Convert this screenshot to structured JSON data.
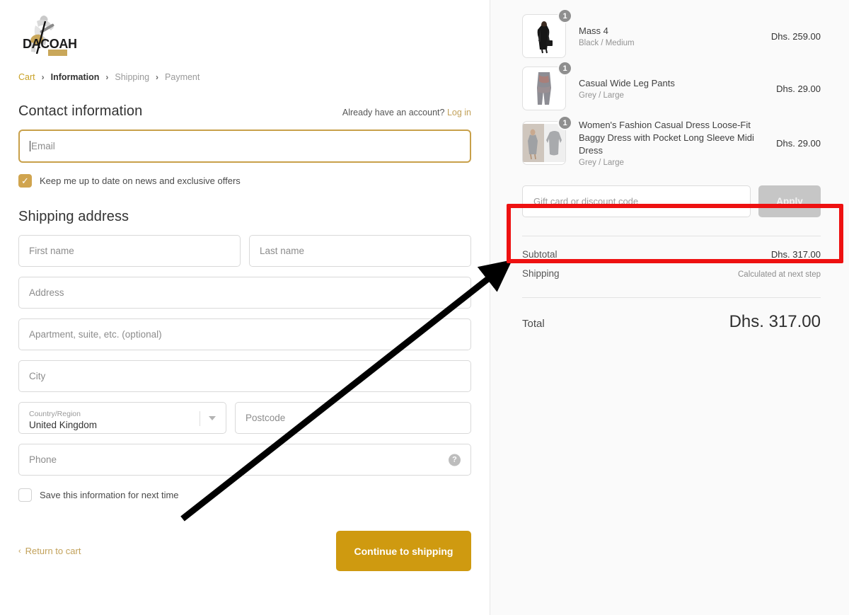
{
  "brand": {
    "name": "DACOAH",
    "logo_icon": "guitarist-logo",
    "accent": "#cf9a10",
    "link_gold": "#c2a15a"
  },
  "breadcrumb": [
    {
      "label": "Cart",
      "state": "link"
    },
    {
      "label": "Information",
      "state": "current"
    },
    {
      "label": "Shipping",
      "state": "muted"
    },
    {
      "label": "Payment",
      "state": "muted"
    }
  ],
  "breadcrumb_separator": "›",
  "contact": {
    "title": "Contact information",
    "account_prompt": "Already have an account?",
    "login_label": "Log in",
    "email_placeholder": "Email",
    "email_value": "",
    "newsletter_label": "Keep me up to date on news and exclusive offers",
    "newsletter_checked": true,
    "check_glyph": "✓"
  },
  "shipping": {
    "title": "Shipping address",
    "first_name_placeholder": "First name",
    "last_name_placeholder": "Last name",
    "address_placeholder": "Address",
    "apartment_placeholder": "Apartment, suite, etc. (optional)",
    "city_placeholder": "City",
    "country_label": "Country/Region",
    "country_value": "United Kingdom",
    "postcode_placeholder": "Postcode",
    "phone_placeholder": "Phone",
    "phone_help_glyph": "?",
    "save_info_label": "Save this information for next time",
    "save_info_checked": false
  },
  "actions": {
    "return_to_cart": "Return to cart",
    "return_chevron": "‹",
    "continue_label": "Continue to shipping"
  },
  "cart": {
    "items": [
      {
        "title": "Mass 4",
        "variant": "Black / Medium",
        "price": "Dhs. 259.00",
        "qty": "1",
        "thumb_icon": "black-coat-model-thumbnail"
      },
      {
        "title": "Casual Wide Leg Pants",
        "variant": "Grey / Large",
        "price": "Dhs. 29.00",
        "qty": "1",
        "thumb_icon": "grey-wide-leg-pants-thumbnail"
      },
      {
        "title": "Women's Fashion Casual Dress Loose-Fit Baggy Dress with Pocket Long Sleeve Midi Dress",
        "variant": "Grey / Large",
        "price": "Dhs. 29.00",
        "qty": "1",
        "thumb_icon": "grey-midi-dress-thumbnail"
      }
    ]
  },
  "discount": {
    "placeholder": "Gift card or discount code",
    "value": "",
    "apply_label": "Apply",
    "highlight_color": "#ee1111"
  },
  "summary": {
    "subtotal_label": "Subtotal",
    "subtotal_value": "Dhs. 317.00",
    "shipping_label": "Shipping",
    "shipping_value": "Calculated at next step",
    "total_label": "Total",
    "total_value": "Dhs. 317.00"
  }
}
